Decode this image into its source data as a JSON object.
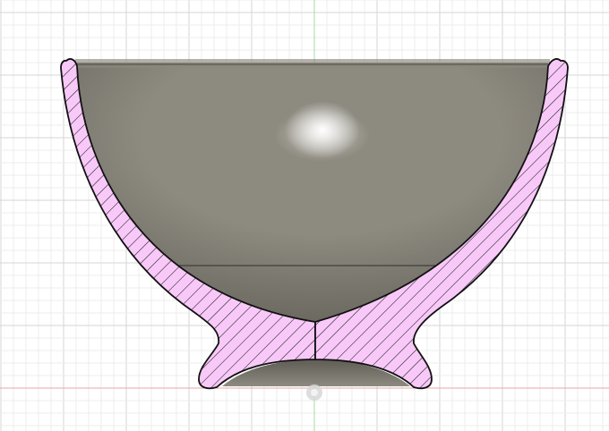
{
  "viewport": {
    "background": "#ffffff",
    "grid_minor_color": "#ececec",
    "grid_major_color": "#d6d6d6",
    "axis_vertical_color": "#a8d9a8",
    "axis_horizontal_color": "#e8a6a6"
  },
  "model": {
    "section_fill": "#f8c9f8",
    "section_outline": "#111111",
    "hatch_color": "#1a1a1a",
    "metal_dark": "#5e5c54",
    "metal_mid": "#8d8a80",
    "metal_light": "#c4c2ba",
    "highlight": "#ffffff"
  },
  "origin_marker": {
    "icon": "origin-point-icon",
    "color": "#9a9a9a"
  }
}
